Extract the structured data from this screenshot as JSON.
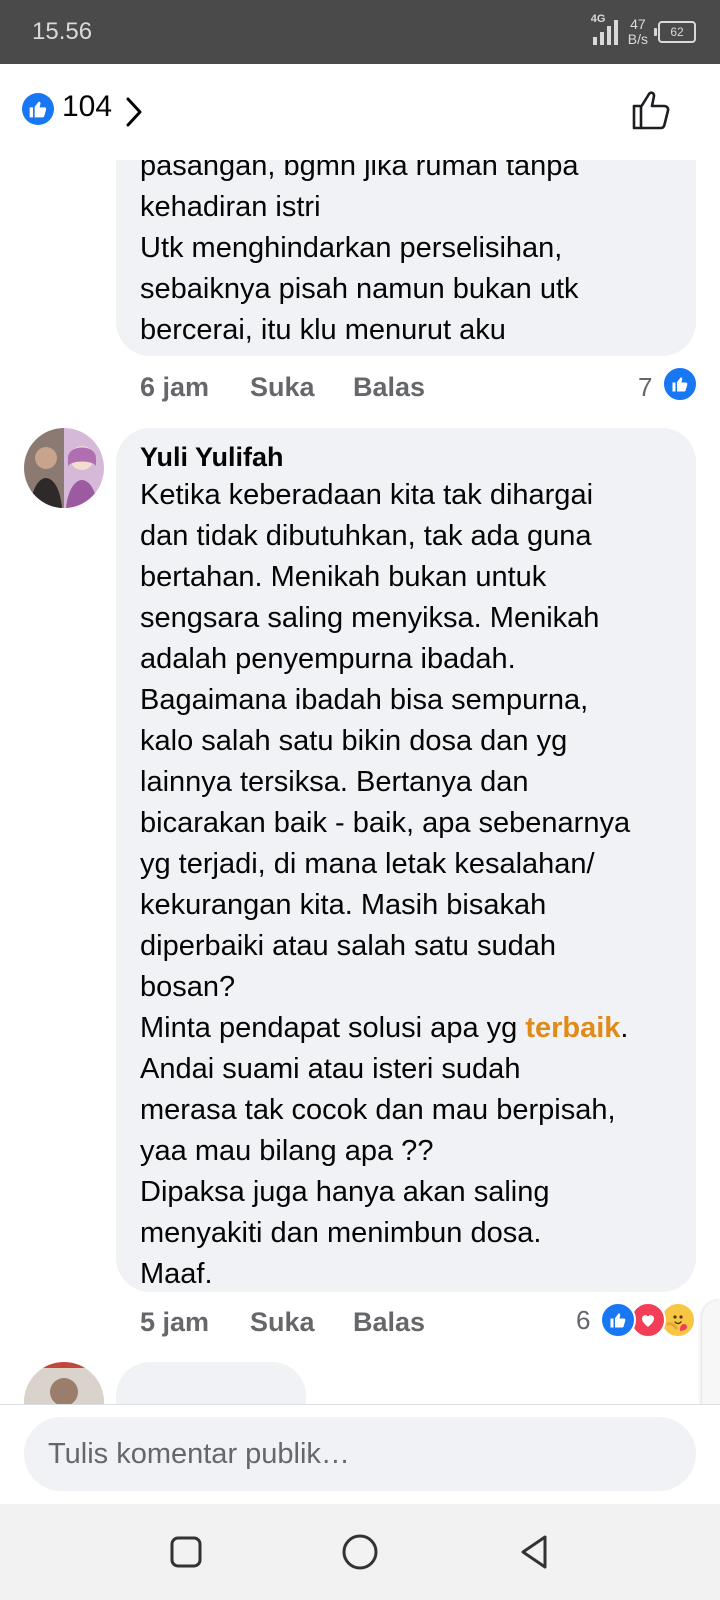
{
  "status_bar": {
    "time": "15.56",
    "network": "4G",
    "speed_value": "47",
    "speed_unit": "B/s",
    "battery": "62"
  },
  "header": {
    "like_count": "104"
  },
  "comments": [
    {
      "partial": true,
      "text": "pasangan, bgmn jika rumah tanpa\nkehadiran  istri\nUtk menghindarkan perselisihan,\nsebaiknya pisah namun bukan utk\nbercerai, itu klu menurut aku",
      "time": "6 jam",
      "like_label": "Suka",
      "reply_label": "Balas",
      "reaction_count": "7",
      "reactions": [
        "like-icon"
      ]
    },
    {
      "author": "Yuli Yulifah",
      "text_before": "Ketika keberadaan kita tak dihargai\ndan tidak dibutuhkan, tak ada guna\nbertahan. Menikah bukan untuk\nsengsara saling menyiksa. Menikah\nadalah penyempurna ibadah.\nBagaimana ibadah bisa sempurna,\nkalo salah satu bikin dosa dan yg\nlainnya tersiksa. Bertanya dan\nbicarakan baik - baik, apa sebenarnya\nyg terjadi, di mana letak kesalahan/\nkekurangan kita. Masih bisakah\ndiperbaiki atau salah satu sudah\nbosan?\nMinta pendapat solusi apa yg ",
      "highlight": "terbaik",
      "text_after": ".\nAndai suami atau isteri sudah\nmerasa tak cocok dan mau berpisah,\nyaa mau bilang apa ??\nDipaksa juga hanya akan saling\nmenyakiti dan menimbun dosa.\nMaaf.",
      "time": "5 jam",
      "like_label": "Suka",
      "reply_label": "Balas",
      "reaction_count": "6",
      "reactions": [
        "like-icon",
        "love-icon",
        "care-icon"
      ]
    }
  ],
  "composer": {
    "placeholder": "Tulis komentar publik…"
  },
  "colors": {
    "facebook_blue": "#1877f2",
    "love_red": "#f33e58",
    "highlight_orange": "#e08a18",
    "bubble_bg": "#f0f2f5"
  }
}
